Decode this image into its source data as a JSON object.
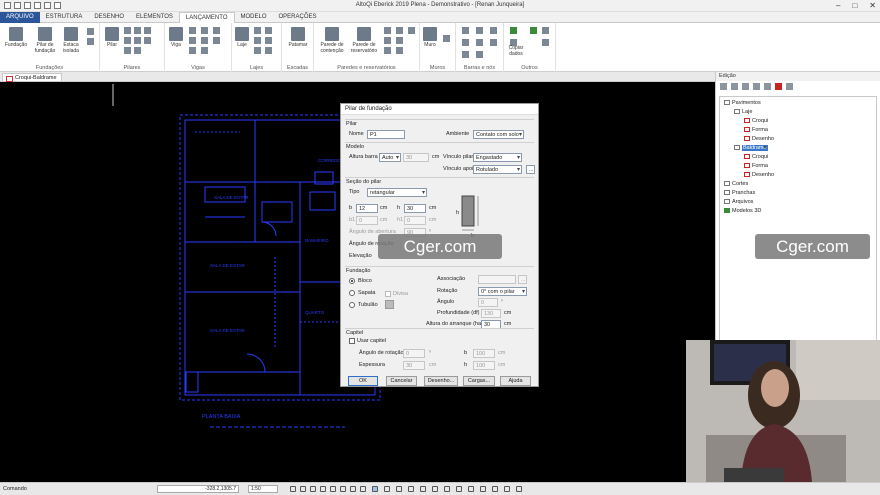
{
  "window": {
    "title": "AltoQi Eberick 2019 Plena - Demonstrativo - [Renan Junqueira]"
  },
  "menu": {
    "tabs": [
      "ARQUIVO",
      "ESTRUTURA",
      "DESENHO",
      "ELEMENTOS",
      "LANÇAMENTO",
      "MODELO",
      "OPERAÇÕES"
    ],
    "active": "LANÇAMENTO"
  },
  "ribbon": {
    "fundacoes": {
      "label": "Fundações",
      "buttons": [
        "Fundação",
        "Pilar de fundação",
        "Estaca isolada"
      ]
    },
    "pilares": {
      "label": "Pilares",
      "buttons": [
        "Pilar"
      ]
    },
    "vigas": {
      "label": "Vigas",
      "buttons": [
        "Viga"
      ]
    },
    "lajes": {
      "label": "Lajes",
      "buttons": [
        "Laje"
      ]
    },
    "escadas": {
      "label": "Escadas",
      "buttons": [
        "Patamar"
      ]
    },
    "paredes": {
      "label": "Paredes e reservatórios",
      "buttons": [
        "Parede de contenção",
        "Parede de reservatório"
      ]
    },
    "muros": {
      "label": "Muros",
      "buttons": [
        "Muro"
      ]
    },
    "barras": {
      "label": "Barras e nós"
    },
    "outros": {
      "label": "Outros",
      "buttons": [
        "Copiar dados"
      ]
    }
  },
  "doc_tab": "Croqui-Baldrame",
  "panel": {
    "title": "Edição",
    "tree": [
      {
        "label": "Pavimentos",
        "icon": "folder-icon",
        "level": 0
      },
      {
        "label": "Laje",
        "icon": "floor-icon",
        "level": 1
      },
      {
        "label": "Croqui",
        "icon": "sketch-icon",
        "level": 2
      },
      {
        "label": "Forma",
        "icon": "form-icon",
        "level": 2
      },
      {
        "label": "Desenho",
        "icon": "drawing-icon",
        "level": 2
      },
      {
        "label": "Baldrame",
        "icon": "floor-icon",
        "level": 1,
        "selected": true
      },
      {
        "label": "Croqui",
        "icon": "sketch-icon",
        "level": 2
      },
      {
        "label": "Forma",
        "icon": "form-icon",
        "level": 2
      },
      {
        "label": "Desenho",
        "icon": "drawing-icon",
        "level": 2
      },
      {
        "label": "Cortes",
        "icon": "folder-icon",
        "level": 0
      },
      {
        "label": "Pranchas",
        "icon": "folder-icon",
        "level": 0
      },
      {
        "label": "Arquivos",
        "icon": "folder-icon",
        "level": 0
      },
      {
        "label": "Modelos 3D",
        "icon": "model-icon",
        "level": 0
      }
    ]
  },
  "dialog": {
    "title": "Pilar de fundação",
    "pilar": {
      "section": "Pilar",
      "nome_label": "Nome",
      "nome": "P1",
      "ambiente_label": "Ambiente",
      "ambiente": "Contato com solo"
    },
    "modelo": {
      "section": "Modelo",
      "altura_label": "Altura barra",
      "altura_mode": "Auto",
      "altura": "30",
      "unit_cm": "cm",
      "vinculo_pilar_label": "Vínculo pilar",
      "vinculo_pilar": "Engastado",
      "vinculo_apoio_label": "Vínculo apoio",
      "vinculo_apoio": "Rotulado"
    },
    "secao": {
      "section": "Seção do pilar",
      "tipo_label": "Tipo",
      "tipo": "retangular",
      "b_label": "b",
      "b": "12",
      "h_label": "h",
      "h": "30",
      "b1_label": "b1",
      "b1": "0",
      "h1_label": "h1",
      "h1": "0",
      "cm": "cm",
      "abertura_label": "Ângulo de abertura",
      "abertura": "90",
      "rotacao_label": "Ângulo de rotação",
      "elevacao_label": "Elevação",
      "deg": "º",
      "fig_b": "b",
      "fig_h": "h"
    },
    "fundacao": {
      "section": "Fundação",
      "bloco": "Bloco",
      "sapata": "Sapata",
      "divisa": "Divisa",
      "tubulao": "Tubulão",
      "associacao_label": "Associação",
      "rotacao_label": "Rotação",
      "rotacao": "0° com o pilar",
      "angulo_label": "Ângulo",
      "angulo": "0",
      "profundidade_label": "Profundidade (df)",
      "profundidade": "130",
      "arranque_label": "Altura do arranque (ha)",
      "arranque": "30",
      "cm": "cm",
      "deg": "º"
    },
    "capitel": {
      "section": "Capitel",
      "usar_label": "Usar capitel",
      "rotacao_label": "Ângulo de rotação",
      "rotacao": "0",
      "espessura_label": "Espessura",
      "espessura": "30",
      "b_label": "b",
      "b": "100",
      "h_label": "h",
      "h": "100",
      "cm": "cm",
      "deg": "º"
    },
    "buttons": {
      "ok": "OK",
      "cancel": "Cancelar",
      "desenho": "Desenho...",
      "cargas": "Cargas...",
      "ajuda": "Ajuda"
    }
  },
  "statusbar": {
    "label": "Comando",
    "coords": "-328.2,1305.7",
    "scale": "1:50"
  },
  "watermark": "Cger.com",
  "canvas_texts": [
    "SALA DE ESTAR",
    "SALA DE ESTAR",
    "BANHEIRO",
    "CORREDOR",
    "SALA DE ESTAR",
    "QUARTO",
    "PLANTA BAIXA"
  ],
  "colors": {
    "cad_line": "#2a3cff",
    "ribbon_blue": "#2b579a",
    "selection": "#3b77c7",
    "background": "#000000"
  }
}
